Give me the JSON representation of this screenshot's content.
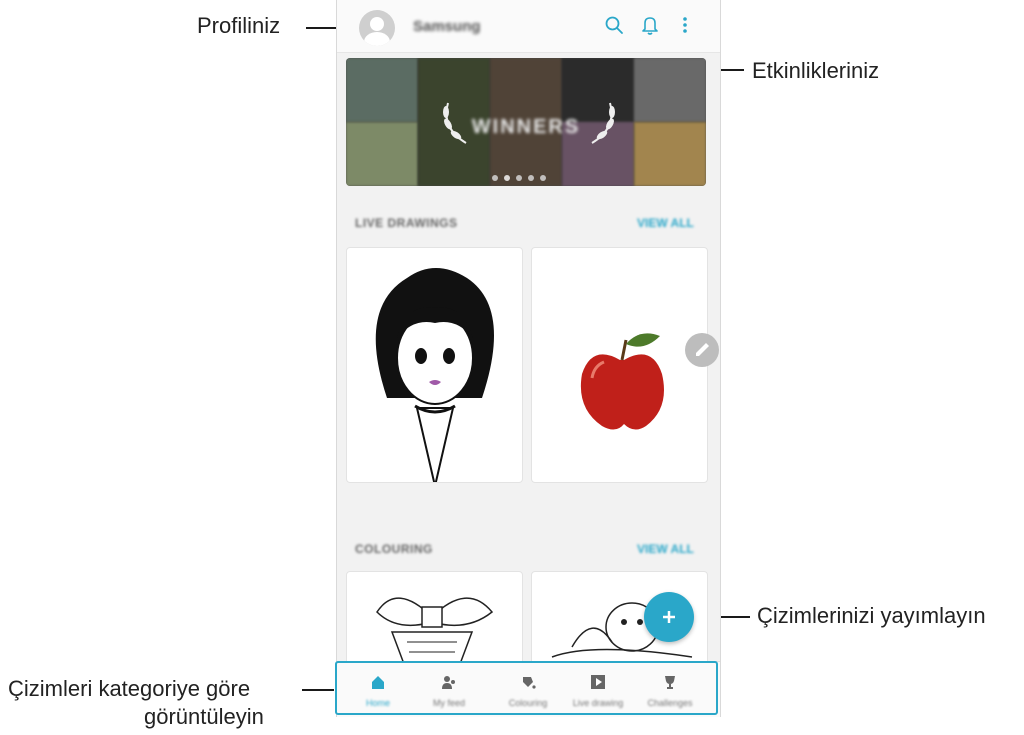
{
  "app": {
    "username": "Samsung",
    "banner_text": "WINNERS",
    "banner_dot_count": 5,
    "banner_active_dot": 2
  },
  "sections": {
    "live_drawings": {
      "title": "LIVE DRAWINGS",
      "view_all": "VIEW ALL"
    },
    "colouring": {
      "title": "COLOURING",
      "view_all": "VIEW ALL"
    }
  },
  "bottom_nav": {
    "items": [
      {
        "label": "Home",
        "icon": "home-icon",
        "active": true
      },
      {
        "label": "My feed",
        "icon": "people-icon",
        "active": false
      },
      {
        "label": "Colouring",
        "icon": "paint-icon",
        "active": false
      },
      {
        "label": "Live drawing",
        "icon": "play-icon",
        "active": false
      },
      {
        "label": "Challenges",
        "icon": "trophy-icon",
        "active": false
      }
    ]
  },
  "callouts": {
    "profile": "Profiliniz",
    "notifications": "Etkinlikleriniz",
    "publish": "Çizimlerinizi yayımlayın",
    "categories_line1": "Çizimleri kategoriye göre",
    "categories_line2": "görüntüleyin"
  },
  "colors": {
    "accent": "#2aa7c9",
    "background": "#f2f2f2"
  }
}
